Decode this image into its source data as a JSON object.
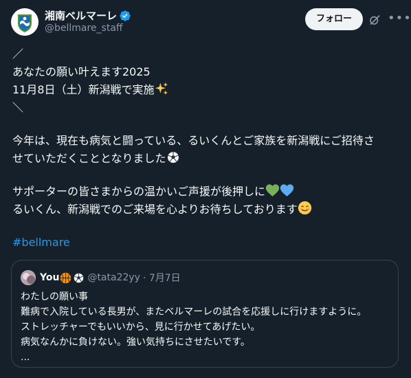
{
  "account": {
    "display_name": "湘南ベルマーレ",
    "handle": "@bellmare_staff",
    "follow_label": "フォロー"
  },
  "post": {
    "line1": "／",
    "line2": "あなたの願い叶えます2025",
    "line3": "11月8日（土）新潟戦で実施",
    "line4": "＼",
    "line5": "今年は、現在も病気と闘っている、るいくんとご家族を新潟戦にご招待さ",
    "line6": "せていただくこととなりました",
    "line7": "サポーターの皆さまからの温かいご声援が後押しに",
    "line8": "るいくん、新潟戦でのご来場を心よりお待ちしております",
    "hashtag": "#bellmare"
  },
  "quote": {
    "name": "You",
    "handle": "@tata22yy",
    "date": "· 7月7日",
    "line1": "わたしの願い事",
    "line2": "難病で入院している長男が、またベルマーレの試合を応援しに行けますように。",
    "line3": "ストレッチャーでもいいから、見に行かせてあげたい。",
    "line4": "病気なんかに負けない。強い気持ちにさせたいです。",
    "line5": "..."
  },
  "colors": {
    "background": "#15202b",
    "text": "#f7f9f9",
    "muted": "#8b98a5",
    "link": "#1d9bf0",
    "verified": "#1d9bf0",
    "border": "#38444d"
  }
}
